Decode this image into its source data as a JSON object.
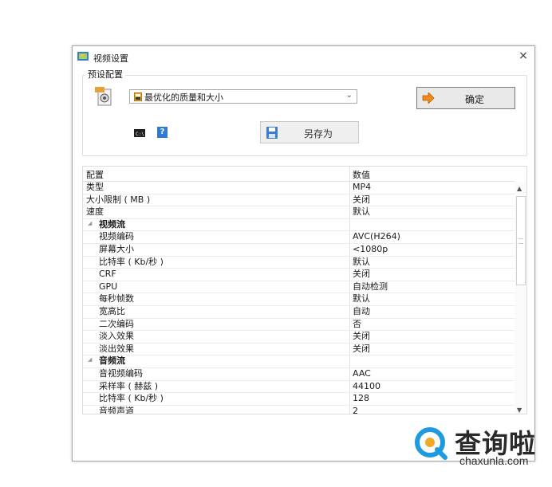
{
  "window": {
    "title": "视频设置",
    "close_glyph": "×"
  },
  "preset": {
    "group_label": "预设配置",
    "selected": "最优化的质量和大小",
    "ok_label": "确定",
    "help_glyph": "?",
    "save_as_label": "另存为"
  },
  "grid": {
    "header_name": "配置",
    "header_value": "数值",
    "rows": [
      {
        "name": "类型",
        "value": "MP4"
      },
      {
        "name": "大小限制 ( MB )",
        "value": "关闭"
      },
      {
        "name": "速度",
        "value": "默认"
      },
      {
        "name": "视频流",
        "value": ""
      },
      {
        "name": "视频编码",
        "value": "AVC(H264)"
      },
      {
        "name": "屏幕大小",
        "value": "<1080p"
      },
      {
        "name": "比特率 ( Kb/秒 )",
        "value": "默认"
      },
      {
        "name": "CRF",
        "value": "关闭"
      },
      {
        "name": "GPU",
        "value": "自动检测"
      },
      {
        "name": "每秒帧数",
        "value": "默认"
      },
      {
        "name": "宽高比",
        "value": "自动"
      },
      {
        "name": "二次编码",
        "value": "否"
      },
      {
        "name": "淡入效果",
        "value": "关闭"
      },
      {
        "name": "淡出效果",
        "value": "关闭"
      },
      {
        "name": "音频流",
        "value": ""
      },
      {
        "name": "音视频编码",
        "value": "AAC"
      },
      {
        "name": "采样率 ( 赫兹 )",
        "value": "44100"
      },
      {
        "name": "比特率 ( Kb/秒 )",
        "value": "128"
      },
      {
        "name": "音频声道",
        "value": "2"
      }
    ]
  },
  "watermark": {
    "brand": "查询啦",
    "url": "chaxunla.com"
  },
  "colors": {
    "accent_orange": "#f08a1c",
    "help_blue": "#2e7bd6",
    "brand_blue": "#1e9be0"
  },
  "icons": {
    "app": "app-film-icon",
    "preset": "mp4-preset-icon",
    "cmd": "command-line-icon",
    "help": "help-icon",
    "disk": "floppy-disk-icon",
    "ok": "orange-arrow-icon"
  }
}
